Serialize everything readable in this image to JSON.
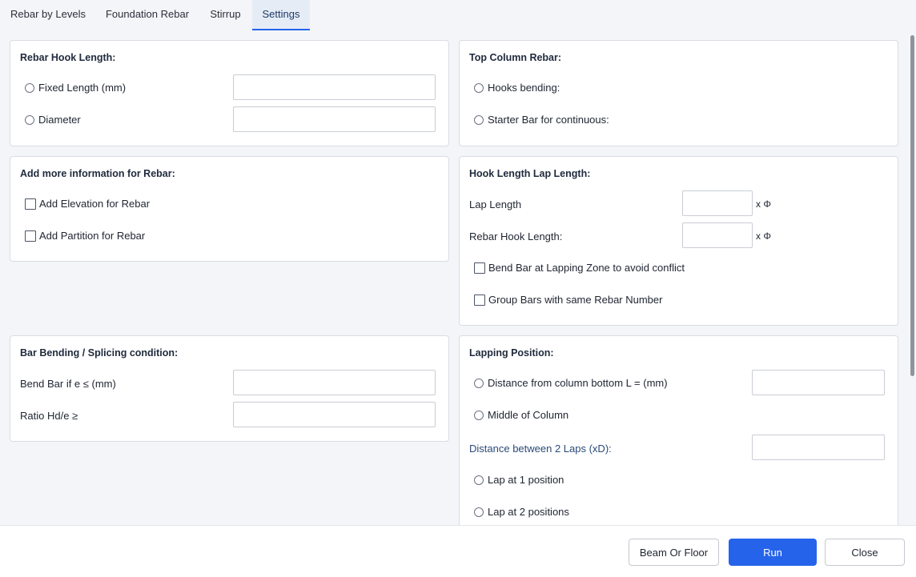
{
  "tabs": [
    {
      "label": "Rebar by Levels"
    },
    {
      "label": "Foundation Rebar"
    },
    {
      "label": "Stirrup"
    },
    {
      "label": "Settings"
    }
  ],
  "panels": {
    "rebar_hook_length": {
      "title": "Rebar Hook Length:",
      "options": [
        {
          "label": "Fixed Length (mm)",
          "value": ""
        },
        {
          "label": "Diameter",
          "value": ""
        }
      ]
    },
    "top_column_rebar": {
      "title": "Top Column Rebar:",
      "options": [
        {
          "label": "Hooks bending:"
        },
        {
          "label": "Starter Bar for continuous:"
        }
      ]
    },
    "add_info": {
      "title": "Add more information for Rebar:",
      "checks": [
        {
          "label": "Add Elevation for Rebar"
        },
        {
          "label": "Add Partition for Rebar"
        }
      ]
    },
    "hook_lap": {
      "title": "Hook Length Lap Length:",
      "fields": [
        {
          "label": "Lap Length",
          "value": "",
          "suffix": "x Φ"
        },
        {
          "label": "Rebar Hook Length:",
          "value": "",
          "suffix": "x Φ"
        }
      ],
      "checks": [
        {
          "label": "Bend Bar at Lapping Zone to avoid conflict"
        },
        {
          "label": "Group Bars with same Rebar Number"
        }
      ]
    },
    "bar_bending": {
      "title": "Bar Bending / Splicing condition:",
      "fields": [
        {
          "label": "Bend Bar if e ≤ (mm)",
          "value": ""
        },
        {
          "label": "Ratio Hd/e ≥",
          "value": ""
        }
      ]
    },
    "lapping_position": {
      "title": "Lapping Position:",
      "distance_option": {
        "label": "Distance from column bottom L = (mm)",
        "value": ""
      },
      "middle_option": {
        "label": "Middle of Column"
      },
      "distance_between": {
        "label": "Distance between 2 Laps (xD):",
        "value": ""
      },
      "lap_options": [
        {
          "label": "Lap at 1 position"
        },
        {
          "label": "Lap at 2 positions"
        }
      ]
    }
  },
  "footer": {
    "beam_or_floor": "Beam Or Floor",
    "run": "Run",
    "close": "Close"
  },
  "colors": {
    "accent": "#2563eb",
    "background": "#f3f5f9",
    "panel": "#ffffff"
  }
}
